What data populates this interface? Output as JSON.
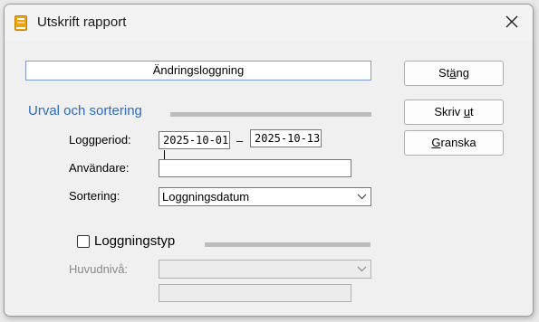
{
  "window": {
    "title": "Utskrift rapport",
    "icon": "report-book-icon",
    "close_icon": "close-icon"
  },
  "report_name": "Ändringsloggning",
  "selection": {
    "heading": "Urval och sortering",
    "log_period_label": "Loggperiod:",
    "date_from": "2025-10-01",
    "date_separator": "–",
    "date_to": "2025-10-13",
    "user_label": "Användare:",
    "user_value": "",
    "sort_label": "Sortering:",
    "sort_value": "Loggningsdatum"
  },
  "log_type": {
    "checkbox_label": "Loggningstyp",
    "checked": false,
    "main_level_label": "Huvudnivå:",
    "main_level_value": "",
    "sub_value": ""
  },
  "buttons": {
    "close": {
      "pre": "St",
      "mnemonic": "ä",
      "post": "ng"
    },
    "print": {
      "pre": "Skriv ",
      "mnemonic": "u",
      "post": "t"
    },
    "preview": {
      "pre": "",
      "mnemonic": "G",
      "post": "ranska"
    }
  },
  "colors": {
    "accent": "#2d6bc4",
    "focus_border": "#7a9cd3",
    "separator": "#bdbdbd",
    "icon_orange": "#f0a30a"
  }
}
